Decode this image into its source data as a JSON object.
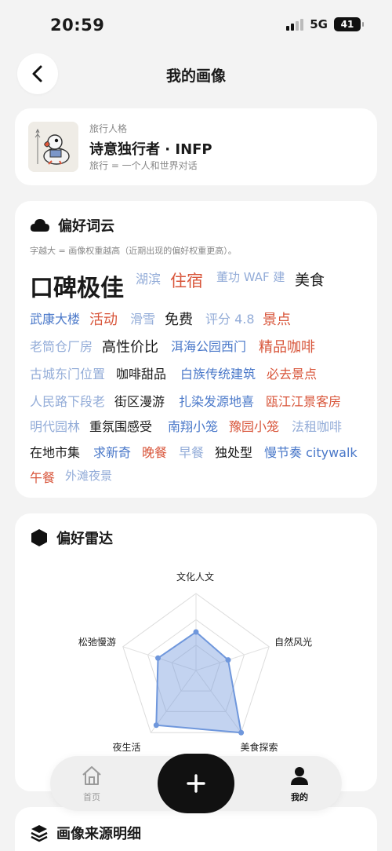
{
  "status_bar": {
    "time": "20:59",
    "network": "5G",
    "battery": "41"
  },
  "header": {
    "title": "我的画像"
  },
  "persona": {
    "kicker": "旅行人格",
    "name": "诗意独行者 · INFP",
    "description": "旅行 = 一个人和世界对话"
  },
  "word_cloud": {
    "title": "偏好词云",
    "note": "字越大 = 画像权重越高（近期出现的偏好权重更高）。",
    "words": [
      {
        "text": "口碑极佳",
        "color": "ink"
      },
      {
        "text": "湖滨",
        "color": "lblue"
      },
      {
        "text": "住宿",
        "color": "red"
      },
      {
        "text": "董功 WAF 建",
        "color": "lblue"
      },
      {
        "text": "美食",
        "color": "ink"
      },
      {
        "text": "武康大楼",
        "color": "blue"
      },
      {
        "text": "活动",
        "color": "red"
      },
      {
        "text": "滑雪",
        "color": "lblue"
      },
      {
        "text": "免费",
        "color": "ink"
      },
      {
        "text": "评分 4.8",
        "color": "lblue"
      },
      {
        "text": "景点",
        "color": "red"
      },
      {
        "text": "老筒仓厂房",
        "color": "lblue"
      },
      {
        "text": "高性价比",
        "color": "ink"
      },
      {
        "text": "洱海公园西门",
        "color": "blue"
      },
      {
        "text": "精品咖啡",
        "color": "red"
      },
      {
        "text": "古城东门位置",
        "color": "lblue"
      },
      {
        "text": "咖啡甜品",
        "color": "ink"
      },
      {
        "text": "白族传统建筑",
        "color": "blue"
      },
      {
        "text": "必去景点",
        "color": "red"
      },
      {
        "text": "人民路下段老",
        "color": "lblue"
      },
      {
        "text": "街区漫游",
        "color": "ink"
      },
      {
        "text": "扎染发源地喜",
        "color": "blue"
      },
      {
        "text": "瓯江江景客房",
        "color": "red"
      },
      {
        "text": "明代园林",
        "color": "lblue"
      },
      {
        "text": "重氛围感受",
        "color": "ink"
      },
      {
        "text": "南翔小笼",
        "color": "blue"
      },
      {
        "text": "豫园小笼",
        "color": "red"
      },
      {
        "text": "法租咖啡",
        "color": "lblue"
      },
      {
        "text": "在地市集",
        "color": "ink"
      },
      {
        "text": "求新奇",
        "color": "blue"
      },
      {
        "text": "晚餐",
        "color": "red"
      },
      {
        "text": "早餐",
        "color": "lblue"
      },
      {
        "text": "独处型",
        "color": "ink"
      },
      {
        "text": "慢节奏 citywalk",
        "color": "blue"
      },
      {
        "text": "午餐",
        "color": "red"
      },
      {
        "text": "外滩夜景",
        "color": "lblue"
      }
    ]
  },
  "radar": {
    "title": "偏好雷达",
    "axes": [
      {
        "label": "文化人文",
        "value": 0.5
      },
      {
        "label": "自然风光",
        "value": 0.44
      },
      {
        "label": "美食探索",
        "value": 1.0
      },
      {
        "label": "夜生活",
        "value": 0.88
      },
      {
        "label": "松弛慢游",
        "value": 0.52
      }
    ],
    "accent": "#6f97dc"
  },
  "sources": {
    "title": "画像来源明细"
  },
  "tabbar": {
    "home": "首页",
    "me": "我的"
  },
  "colors": {
    "ink": "#1a1a1a",
    "blue": "#4a78c9",
    "lblue": "#93acd8",
    "red": "#d8553a"
  }
}
